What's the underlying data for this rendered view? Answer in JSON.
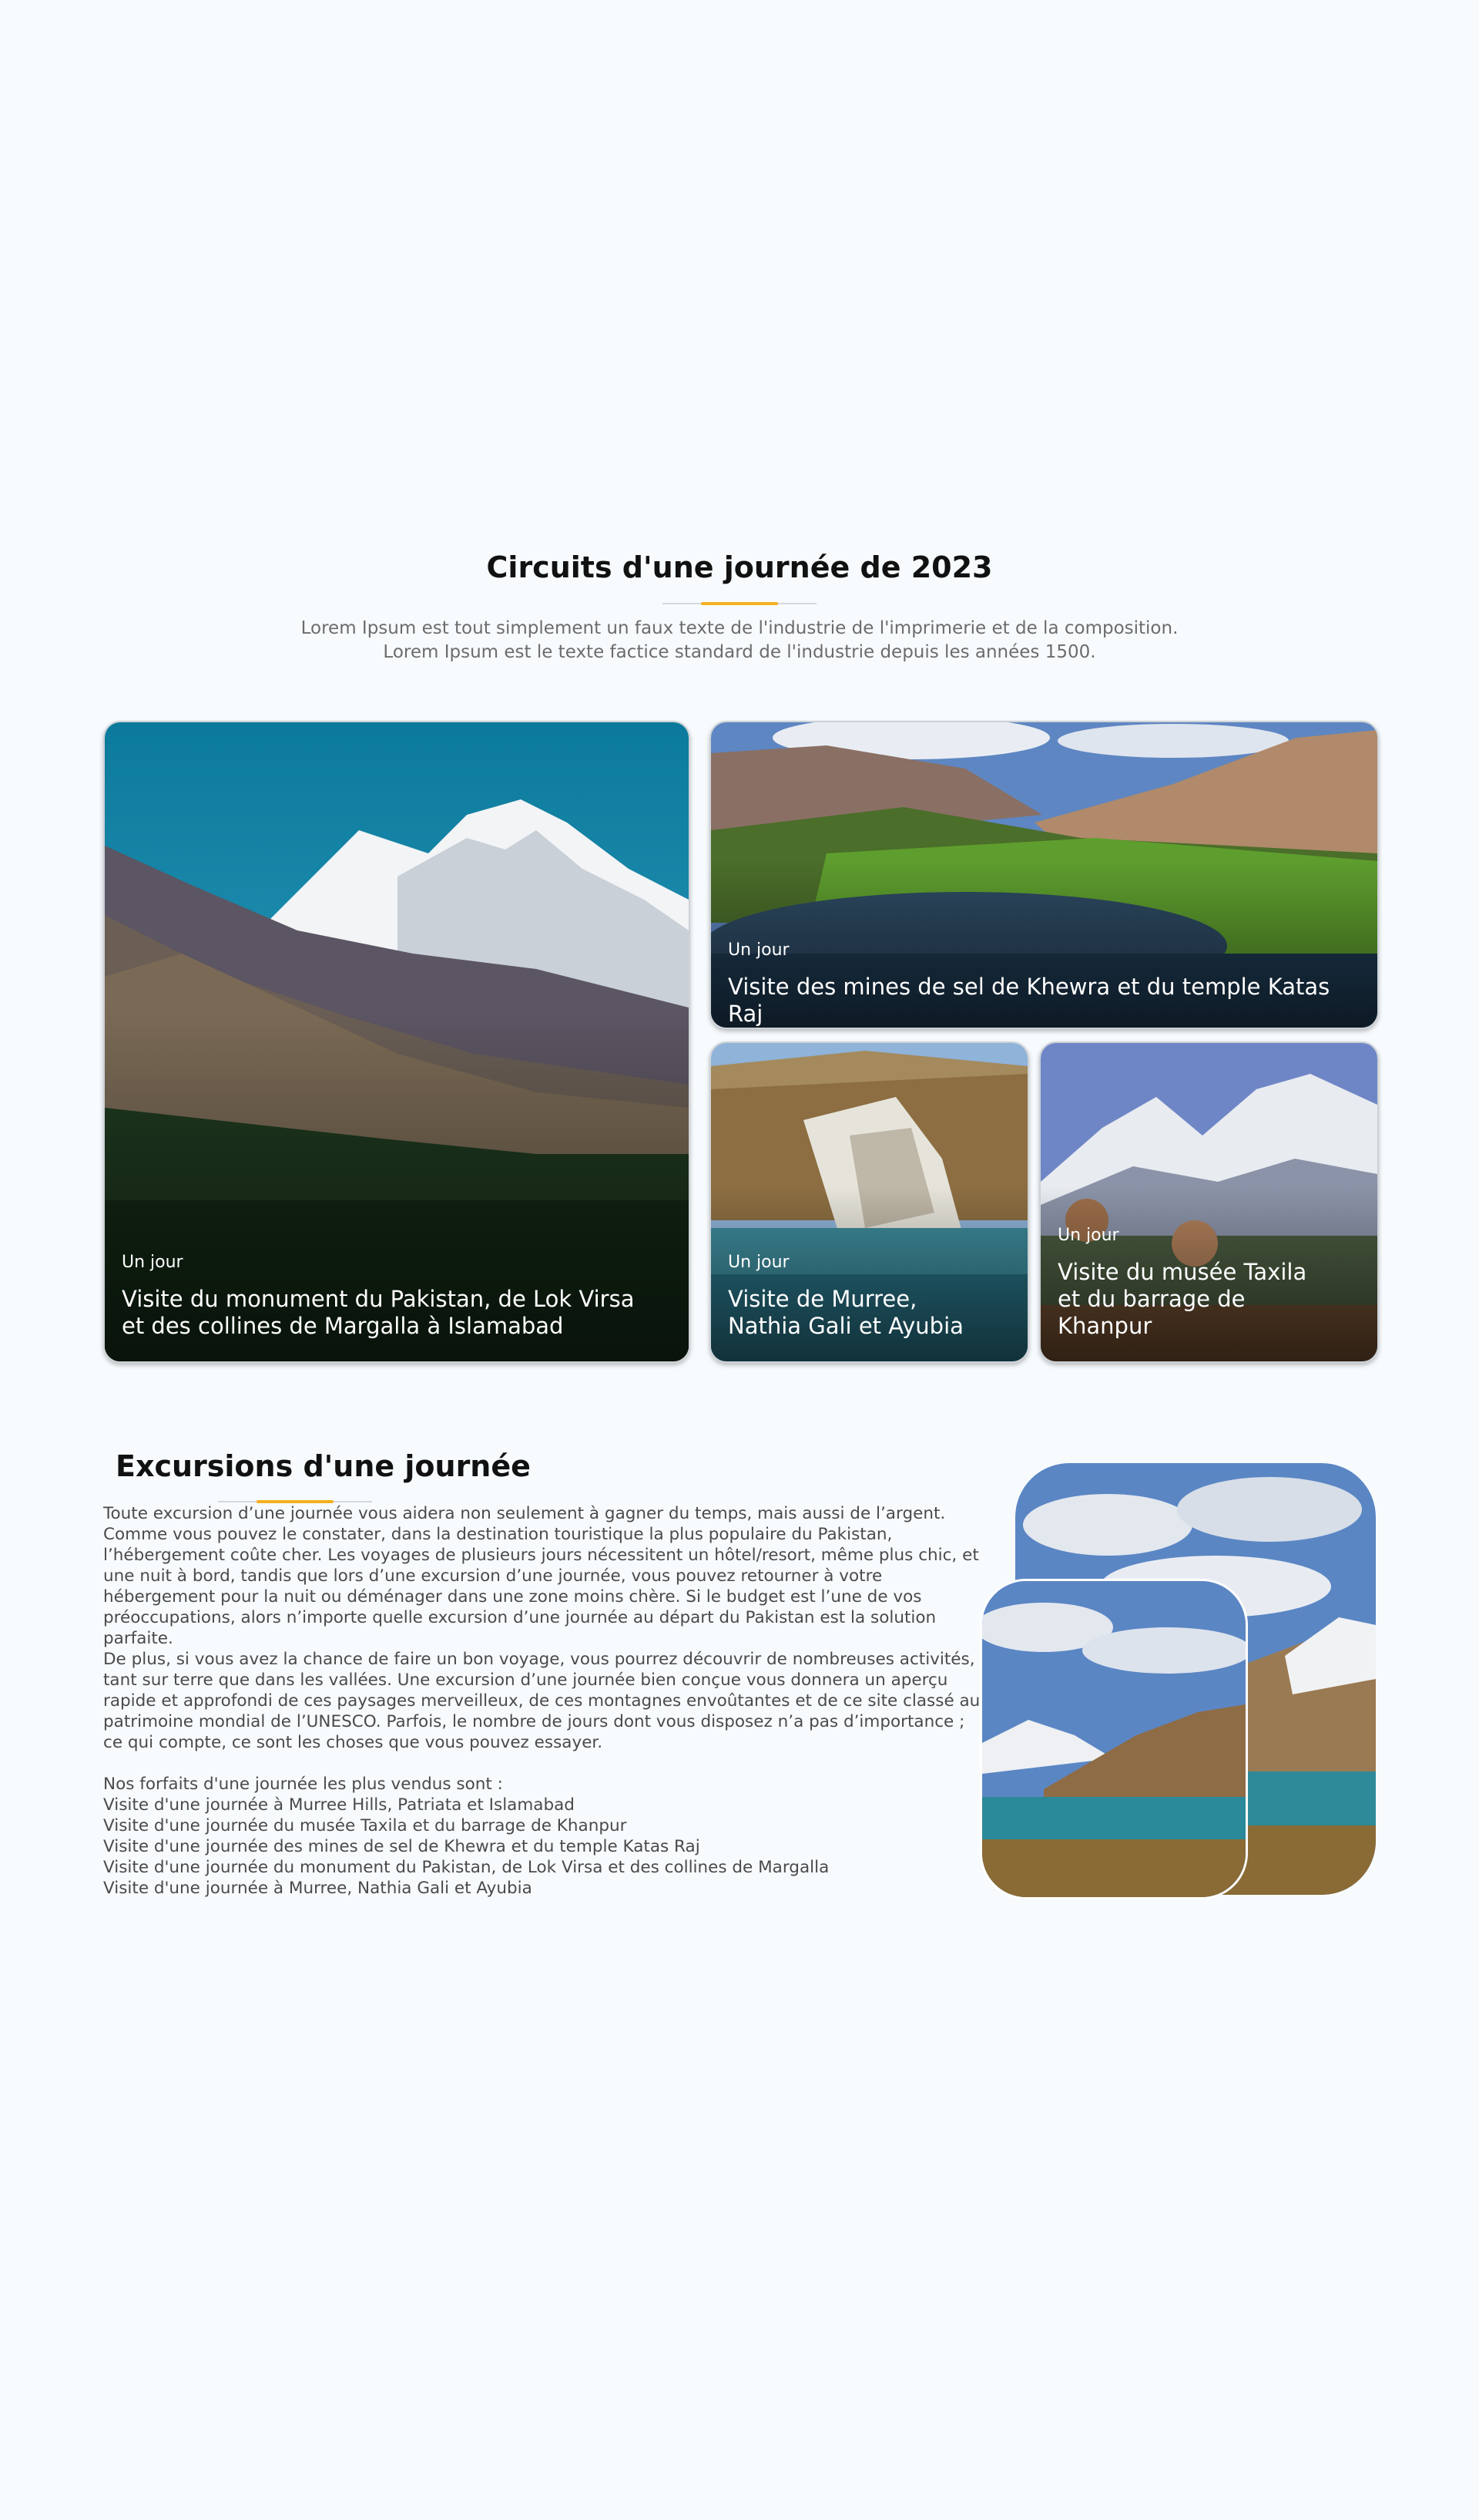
{
  "circuits": {
    "title": "Circuits d'une journée de 2023",
    "description": [
      "Lorem Ipsum est tout simplement un faux texte de l'industrie de l'imprimerie et de la composition.",
      "Lorem Ipsum est le texte factice standard de l'industrie depuis les années 1500."
    ],
    "cards": [
      {
        "tag": "Un jour",
        "title": "Visite du monument du Pakistan, de Lok Virsa et des collines de Margalla à Islamabad"
      },
      {
        "tag": "Un jour",
        "title": "Visite des mines de sel de Khewra et du temple Katas Raj"
      },
      {
        "tag": "Un jour",
        "title": "Visite de Murree, Nathia Gali et Ayubia"
      },
      {
        "tag": "Un jour",
        "title": "Visite du musée Taxila et du barrage de Khanpur"
      }
    ]
  },
  "excursions": {
    "title": "Excursions d'une journée",
    "paragraph1": "Toute excursion d’une journée vous aidera non seulement à gagner du temps, mais aussi de l’argent. Comme vous pouvez le constater, dans la destination touristique la plus populaire du Pakistan, l’hébergement coûte cher. Les voyages de plusieurs jours nécessitent un hôtel/resort, même plus chic, et une nuit à bord, tandis que lors d’une excursion d’une journée, vous pouvez retourner à votre hébergement pour la nuit ou déménager dans une zone moins chère. Si le budget est l’une de vos préoccupations, alors n’importe quelle excursion d’une journée au départ du Pakistan est la solution parfaite.",
    "paragraph2": "De plus, si vous avez la chance de faire un bon voyage, vous pourrez découvrir de nombreuses activités, tant sur terre que dans les vallées. Une excursion d’une journée bien conçue vous donnera un aperçu rapide et approfondi de ces paysages merveilleux, de ces montagnes envoûtantes et de ce site classé au patrimoine mondial de l’UNESCO. Parfois, le nombre de jours dont vous disposez n’a pas d’importance ; ce qui compte, ce sont les choses que vous pouvez essayer.",
    "list_intro": "Nos forfaits d'une journée les plus vendus sont :",
    "list": [
      "Visite d'une journée à Murree Hills, Patriata et Islamabad",
      "Visite d'une journée du musée Taxila et du barrage de Khanpur",
      "Visite d'une journée des mines de sel de Khewra et du temple Katas Raj",
      "Visite d'une journée du monument du Pakistan, de Lok Virsa et des collines de Margalla",
      "Visite d'une journée à Murree, Nathia Gali et Ayubia"
    ]
  },
  "colors": {
    "accent": "#f5b021",
    "background": "#f7fbfe",
    "text": "#111111",
    "muted": "#6c6c6c"
  }
}
